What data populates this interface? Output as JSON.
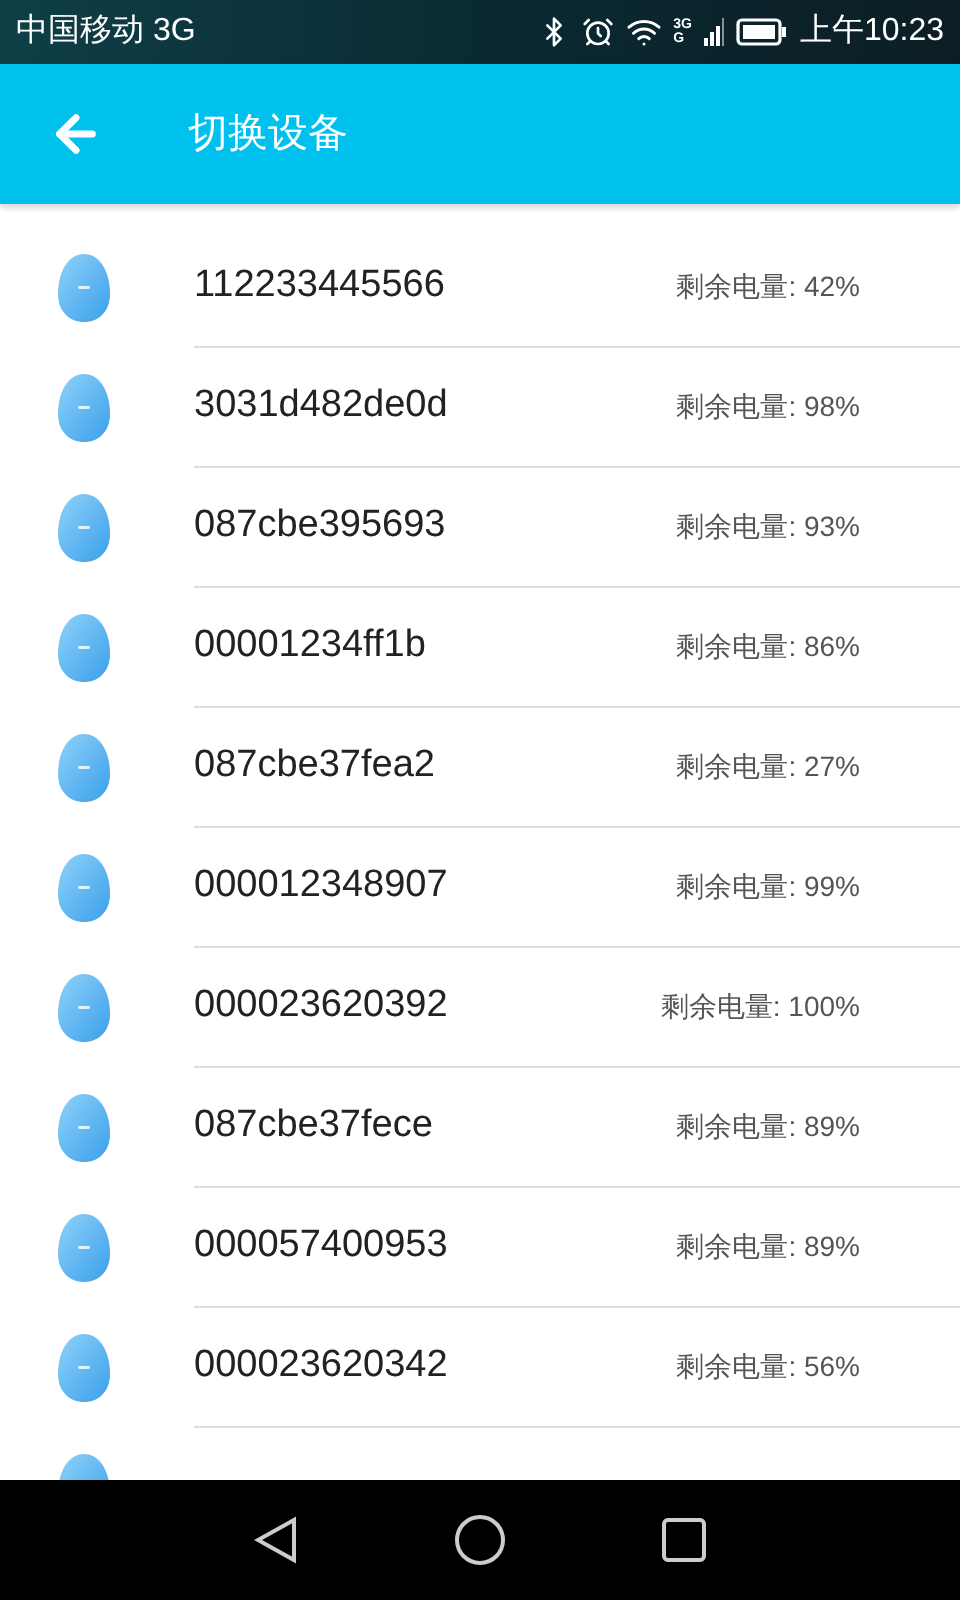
{
  "status_bar": {
    "carrier": "中国移动 3G",
    "network_badge_top": "3G",
    "network_badge_bottom": "G",
    "time": "上午10:23"
  },
  "app_bar": {
    "title": "切换设备"
  },
  "devices": [
    {
      "id": "112233445566",
      "battery": "剩余电量: 42%"
    },
    {
      "id": "3031d482de0d",
      "battery": "剩余电量: 98%"
    },
    {
      "id": "087cbe395693",
      "battery": "剩余电量: 93%"
    },
    {
      "id": "00001234ff1b",
      "battery": "剩余电量: 86%"
    },
    {
      "id": "087cbe37fea2",
      "battery": "剩余电量: 27%"
    },
    {
      "id": "000012348907",
      "battery": "剩余电量: 99%"
    },
    {
      "id": "000023620392",
      "battery": "剩余电量: 100%"
    },
    {
      "id": "087cbe37fece",
      "battery": "剩余电量: 89%"
    },
    {
      "id": "000057400953",
      "battery": "剩余电量: 89%"
    },
    {
      "id": "000023620342",
      "battery": "剩余电量: 56%"
    }
  ],
  "more_below": true
}
